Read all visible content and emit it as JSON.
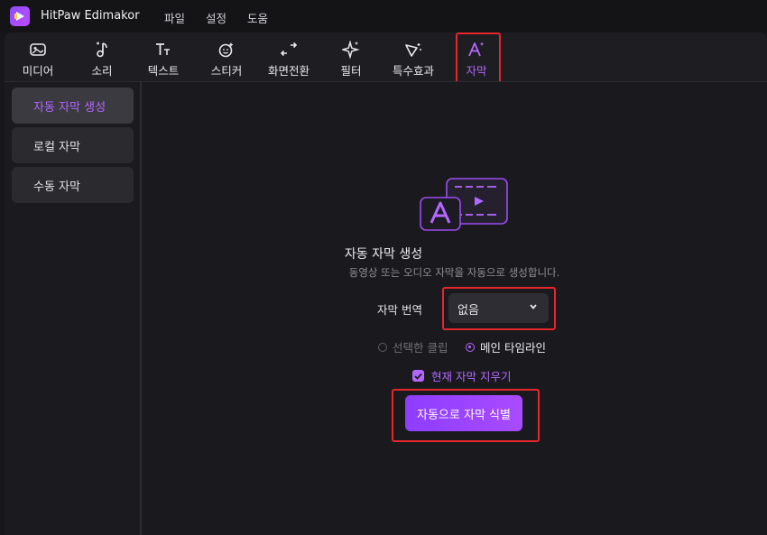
{
  "app": {
    "title": "HitPaw Edimakor"
  },
  "menu": [
    "파일",
    "설정",
    "도움"
  ],
  "toolbar": {
    "items": [
      {
        "label": "미디어",
        "icon": "media-icon"
      },
      {
        "label": "소리",
        "icon": "music-note-icon"
      },
      {
        "label": "텍스트",
        "icon": "text-icon"
      },
      {
        "label": "스티커",
        "icon": "sticker-icon"
      },
      {
        "label": "화면전환",
        "icon": "transition-icon"
      },
      {
        "label": "필터",
        "icon": "filter-sparkle-icon"
      },
      {
        "label": "특수효과",
        "icon": "effects-icon"
      },
      {
        "label": "자막",
        "icon": "subtitle-icon",
        "active": true
      }
    ]
  },
  "sidebar": {
    "items": [
      {
        "label": "자동 자막 생성",
        "active": true
      },
      {
        "label": "로컬 자막"
      },
      {
        "label": "수동 자막"
      }
    ]
  },
  "main": {
    "illustration_icon": "auto-subtitle-illustration",
    "title": "자동 자막 생성",
    "description": "동영상 또는 오디오 자막을 자동으로 생성합니다.",
    "translate_label": "자막 번역",
    "translate_value": "없음",
    "scope_options": [
      {
        "label": "선택한 클립",
        "selected": false
      },
      {
        "label": "메인 타임라인",
        "selected": true
      }
    ],
    "clear_checkbox": {
      "label": "현재 자막 지우기",
      "checked": true
    },
    "action_button": "자동으로 자막 식별"
  },
  "colors": {
    "accent": "#b467ff",
    "highlight_box": "#e5262a",
    "background": "#17171b"
  }
}
